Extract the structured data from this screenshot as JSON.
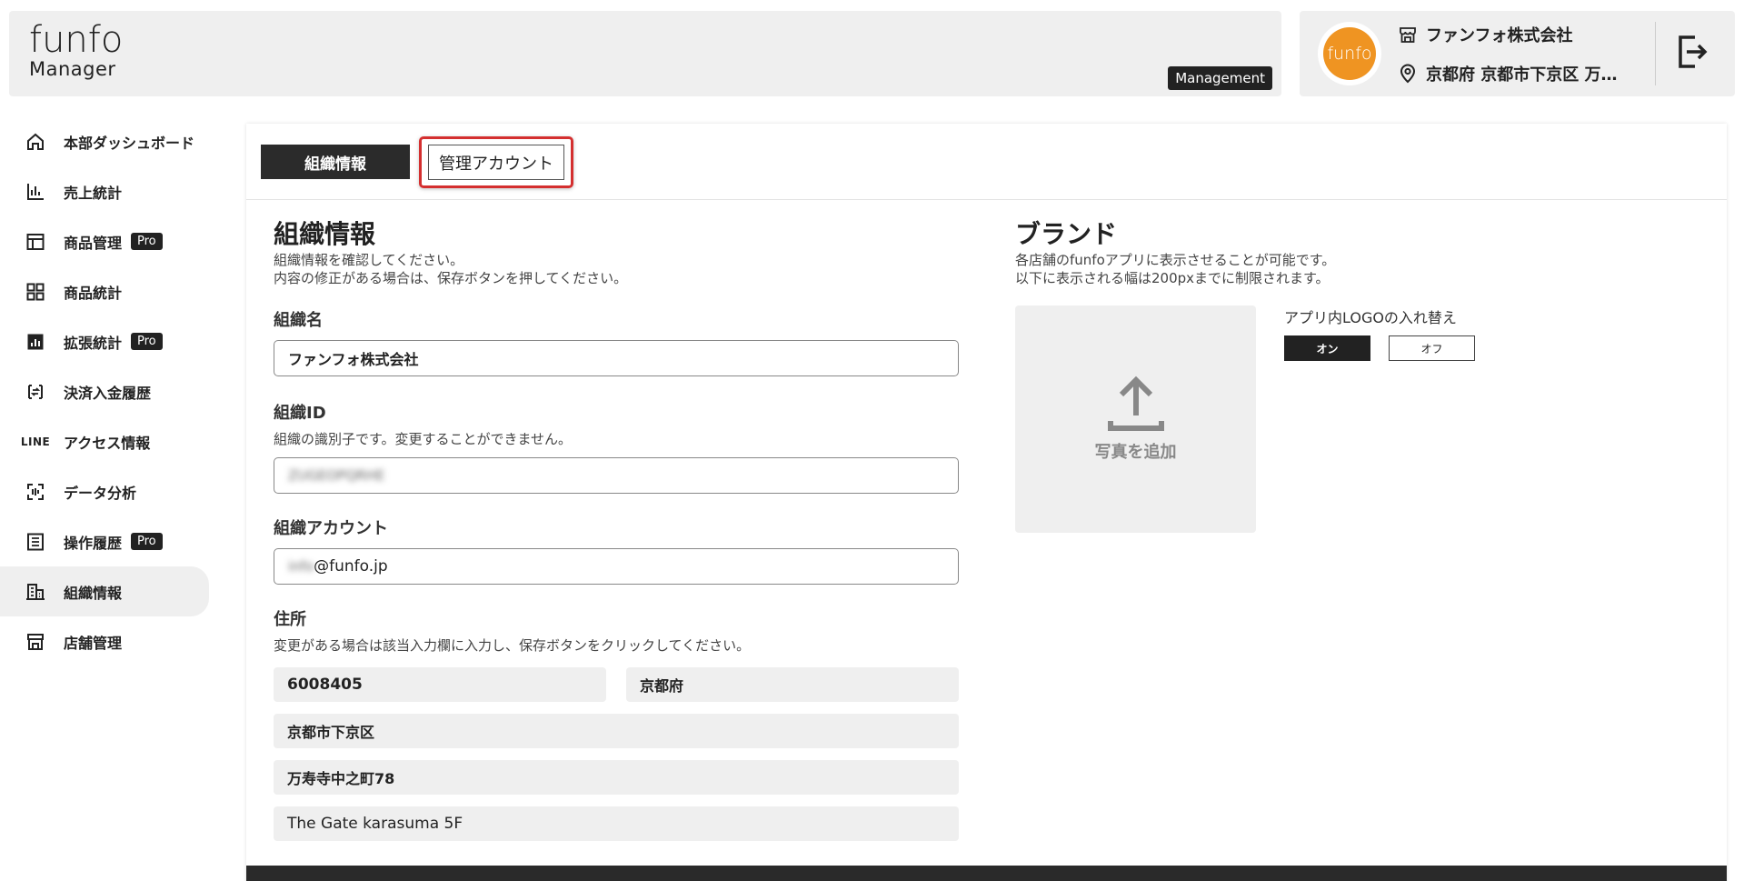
{
  "header": {
    "logo_top": "funfo",
    "logo_bottom": "Manager",
    "mode_badge": "Management",
    "avatar_text": "funfo",
    "org_name": "ファンフォ株式会社",
    "org_location": "京都府 京都市下京区 万…"
  },
  "sidebar": {
    "items": [
      {
        "label": "本部ダッシュボード",
        "icon": "home-icon"
      },
      {
        "label": "売上統計",
        "icon": "bar-chart-icon"
      },
      {
        "label": "商品管理",
        "icon": "layout-icon",
        "badge": "Pro"
      },
      {
        "label": "商品統計",
        "icon": "grid-icon"
      },
      {
        "label": "拡張統計",
        "icon": "chart-box-icon",
        "badge": "Pro"
      },
      {
        "label": "決済入金履歴",
        "icon": "payment-icon"
      },
      {
        "label": "アクセス情報",
        "icon": "line-icon",
        "icon_text": "LINE"
      },
      {
        "label": "データ分析",
        "icon": "scan-icon"
      },
      {
        "label": "操作履歴",
        "icon": "list-icon",
        "badge": "Pro"
      },
      {
        "label": "組織情報",
        "icon": "building-icon",
        "active": true
      },
      {
        "label": "店舗管理",
        "icon": "store-icon"
      }
    ]
  },
  "tabs": {
    "org_info": "組織情報",
    "admin_account": "管理アカウント"
  },
  "org_section": {
    "title": "組織情報",
    "desc1": "組織情報を確認してください。",
    "desc2": "内容の修正がある場合は、保存ボタンを押してください。",
    "name_label": "組織名",
    "name_value": "ファンフォ株式会社",
    "id_label": "組織ID",
    "id_sub": "組織の識別子です。変更することができません。",
    "id_value": "ZUGEOPQRHE",
    "account_label": "組織アカウント",
    "account_value_hidden": "info",
    "account_value_domain": "@funfo.jp",
    "address_label": "住所",
    "address_sub": "変更がある場合は該当入力欄に入力し、保存ボタンをクリックしてください。",
    "postal": "6008405",
    "prefecture": "京都府",
    "city": "京都市下京区",
    "street": "万寿寺中之町78",
    "building": "The Gate karasuma 5F"
  },
  "brand_section": {
    "title": "ブランド",
    "desc1": "各店舗のfunfoアプリに表示させることが可能です。",
    "desc2": "以下に表示される幅は200pxまでに制限されます。",
    "upload_label": "写真を追加",
    "logo_swap_label": "アプリ内LOGOの入れ替え",
    "toggle_on": "オン",
    "toggle_off": "オフ"
  }
}
